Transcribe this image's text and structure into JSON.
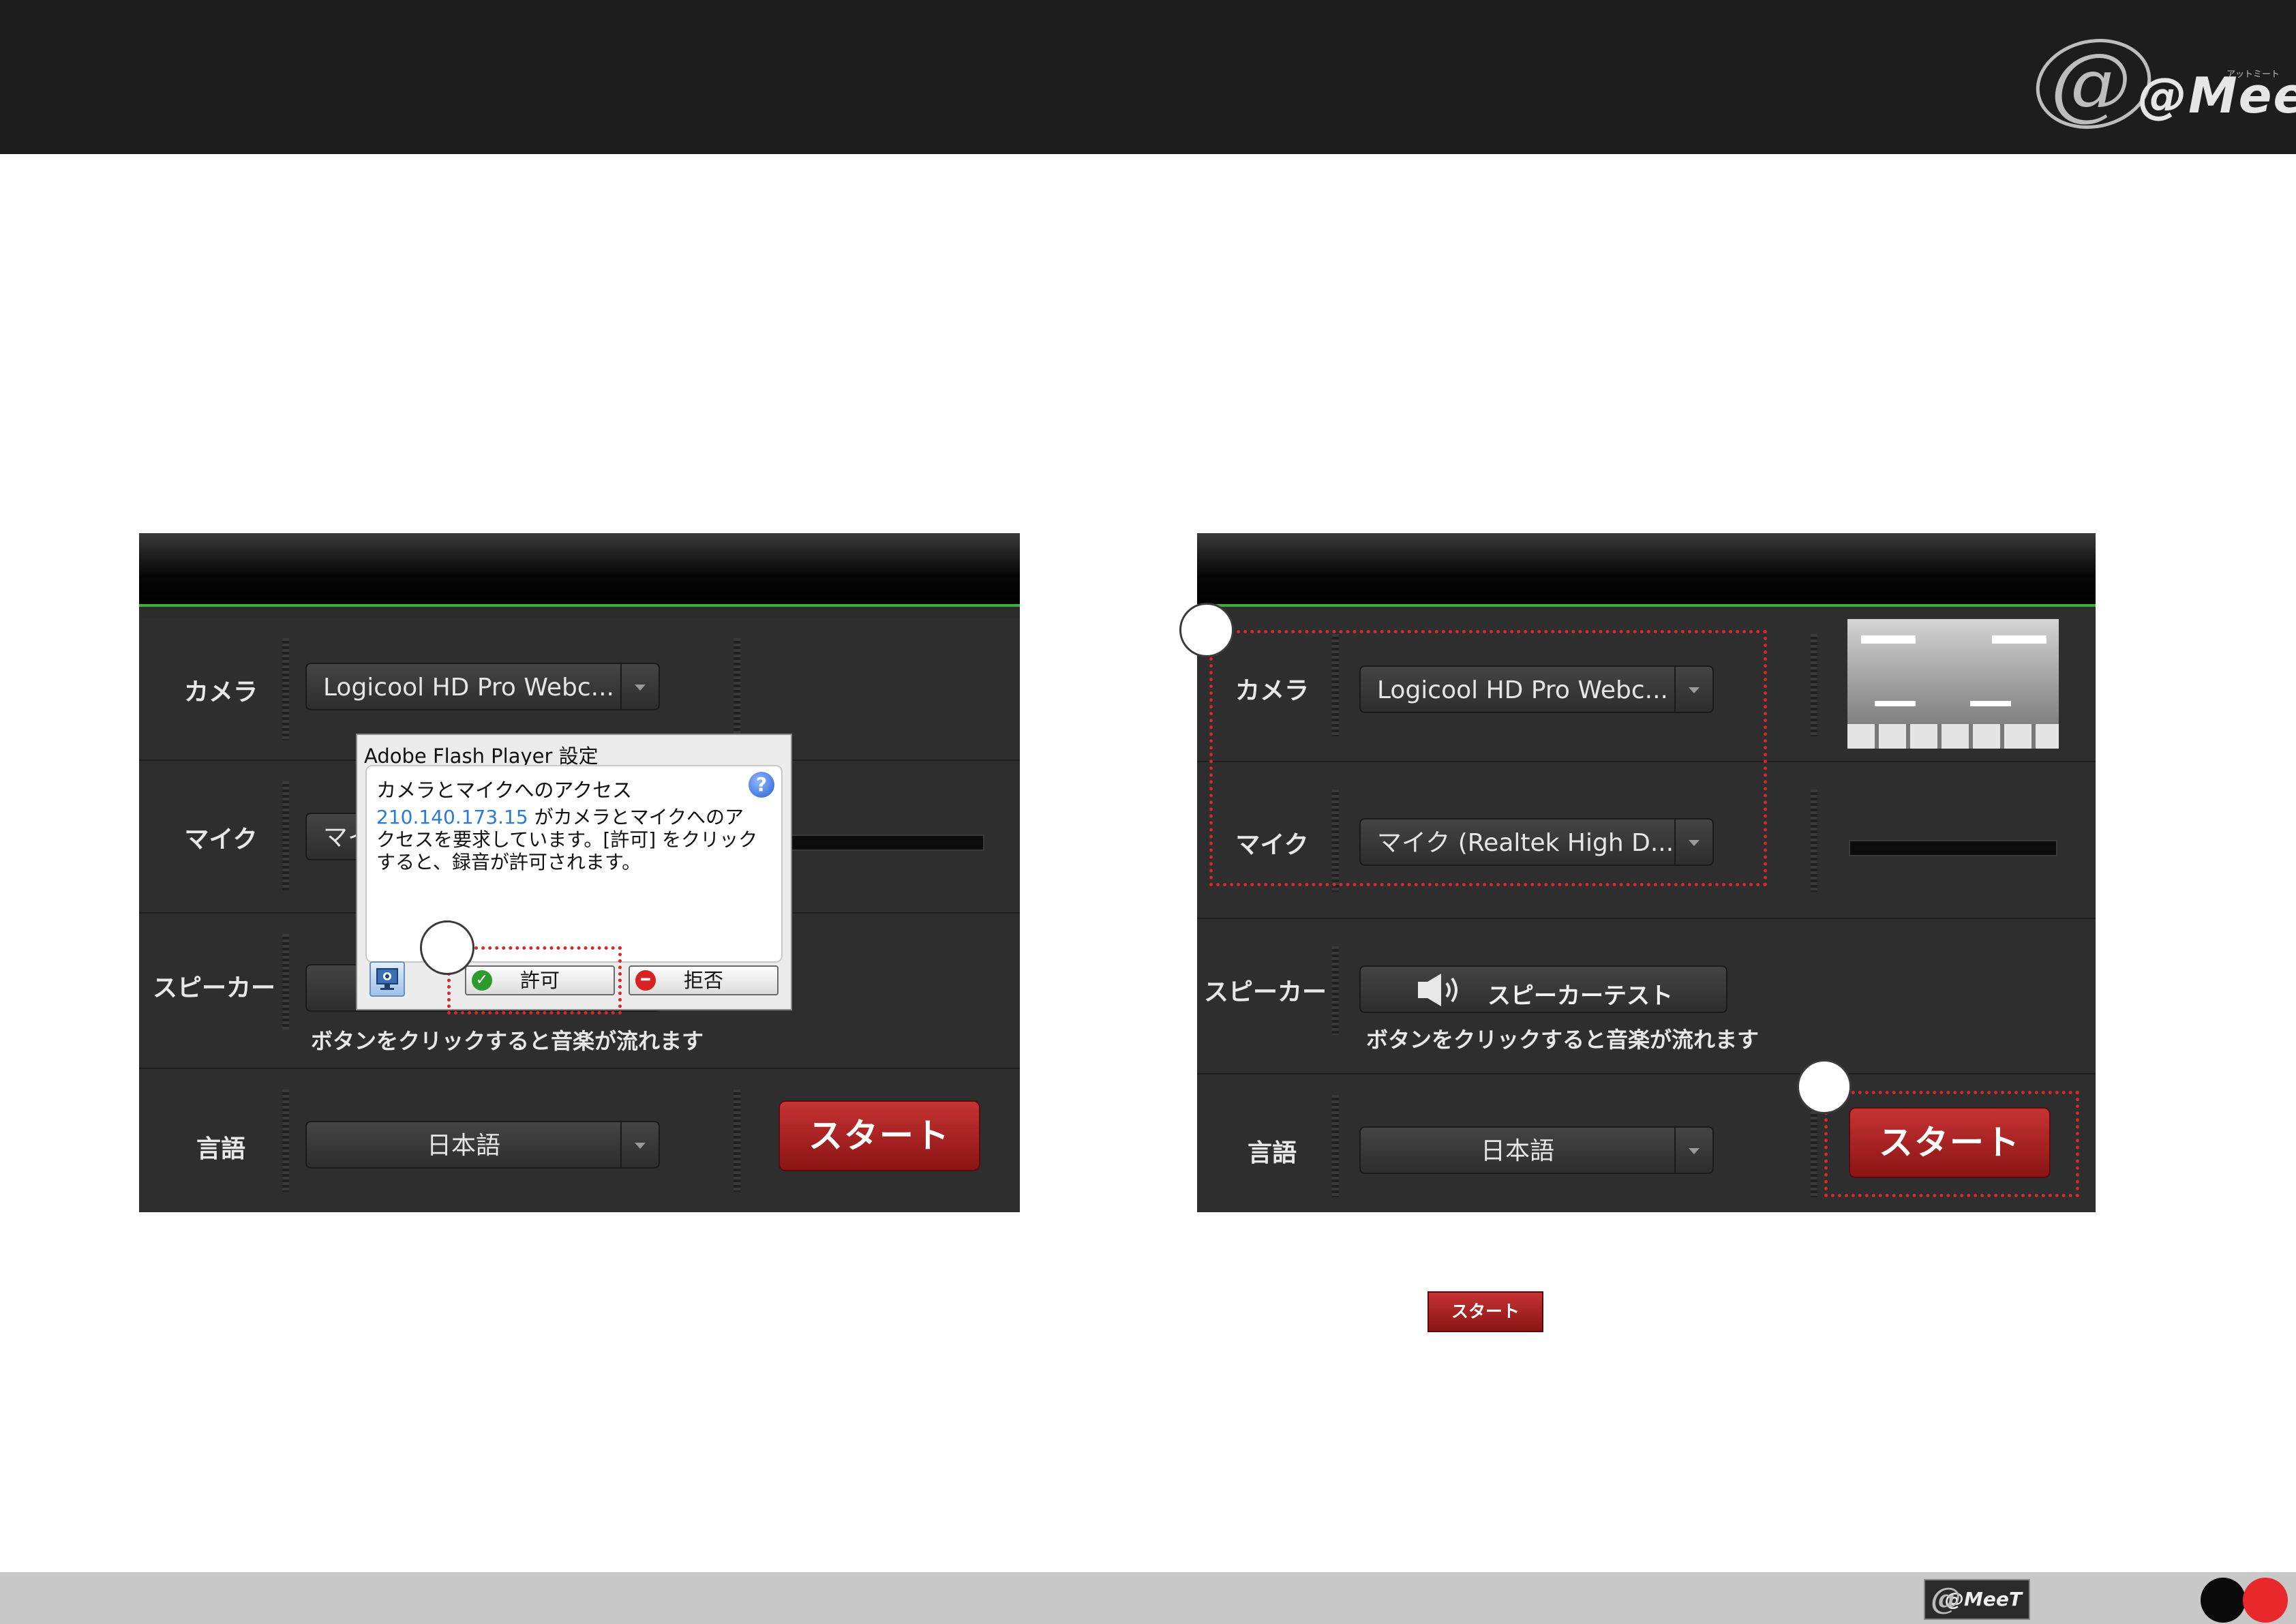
{
  "brand": {
    "logo_text": "@MeeT",
    "logo_small": "アットミート"
  },
  "left_panel": {
    "rows": {
      "camera": {
        "label": "カメラ",
        "value": "Logicool HD Pro Webc..."
      },
      "mic": {
        "label": "マイク",
        "value_partial": "マイ"
      },
      "speaker": {
        "label": "スピーカー",
        "hint": "ボタンをクリックすると音楽が流れます"
      },
      "language": {
        "label": "言語",
        "value": "日本語",
        "start_label": "スタート"
      }
    }
  },
  "flash_dialog": {
    "title": "Adobe Flash Player 設定",
    "heading": "カメラとマイクへのアクセス",
    "ip": "210.140.173.15",
    "message_1": " がカメラとマイクへのア",
    "message_2": "クセスを要求しています。[許可] をクリック",
    "message_3": "すると、録音が許可されます。",
    "help_symbol": "?",
    "allow_label": "許可",
    "deny_label": "拒否",
    "icons": {
      "monitor": "monitor-icon",
      "allow": "check-icon",
      "deny": "no-entry-icon"
    }
  },
  "right_panel": {
    "rows": {
      "camera": {
        "label": "カメラ",
        "value": "Logicool HD Pro Webc..."
      },
      "mic": {
        "label": "マイク",
        "value": "マイク (Realtek High D..."
      },
      "speaker": {
        "label": "スピーカー",
        "test_label": "スピーカーテスト",
        "hint": "ボタンをクリックすると音楽が流れます"
      },
      "language": {
        "label": "言語",
        "value": "日本語",
        "start_label": "スタート"
      }
    }
  },
  "caption_button": {
    "label": "スタート"
  },
  "colors": {
    "header": "#1d1d1d",
    "accent_green": "#3fae3f",
    "start_red": "#b52525",
    "marker_red": "#d42a2a",
    "footer": "#c8c8c8"
  }
}
